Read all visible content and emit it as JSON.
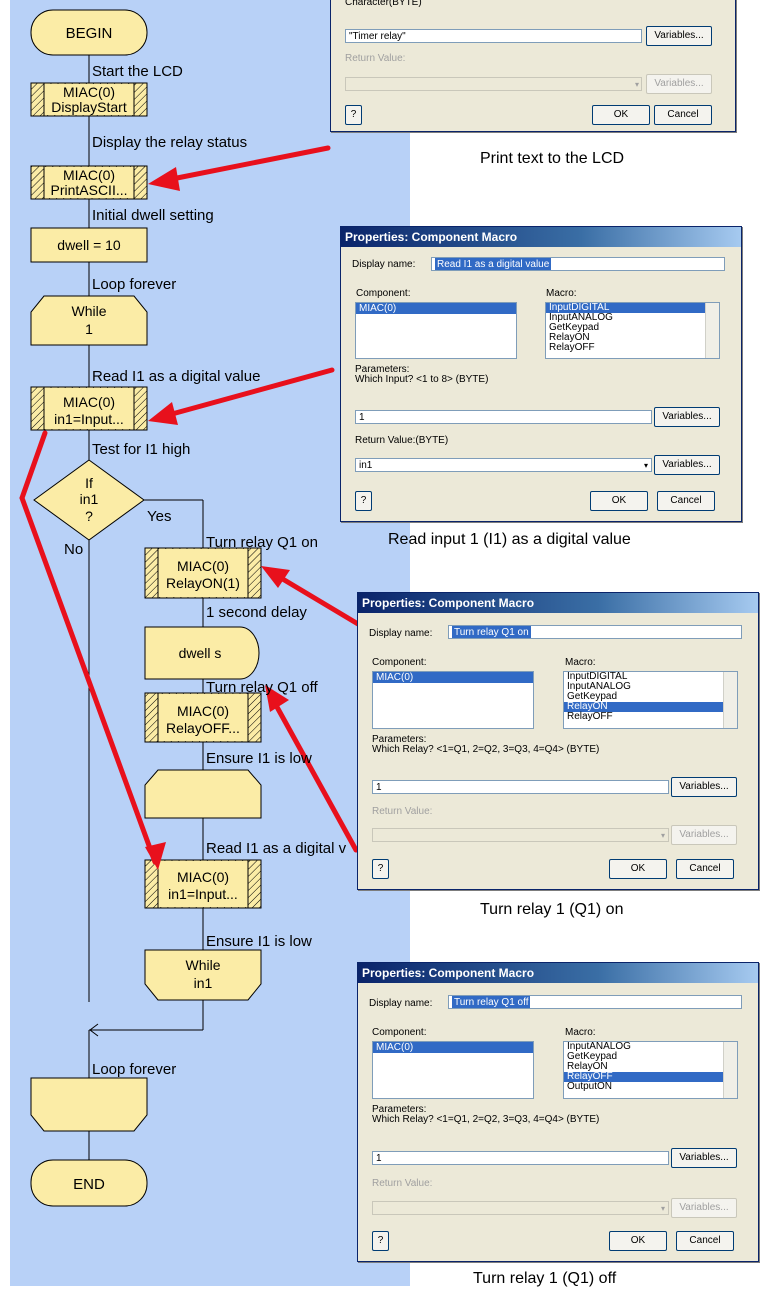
{
  "flowchart": {
    "begin": "BEGIN",
    "end": "END",
    "labels": {
      "start_lcd": "Start the LCD",
      "display_relay": "Display the relay status",
      "initial_dwell": "Initial dwell setting",
      "loop_forever_1": "Loop forever",
      "read_i1_1": "Read I1 as a digital value",
      "test_i1": "Test for I1 high",
      "yes": "Yes",
      "no": "No",
      "relay_on": "Turn relay Q1 on",
      "delay": "1 second delay",
      "relay_off": "Turn relay Q1 off",
      "ensure_low_1": "Ensure I1 is low",
      "read_i1_2": "Read I1 as a digital v",
      "ensure_low_2": "Ensure I1 is low",
      "loop_forever_2": "Loop forever"
    },
    "blocks": {
      "display_start_1": "MIAC(0)",
      "display_start_2": "DisplayStart",
      "print_1": "MIAC(0)",
      "print_2": "PrintASCII...",
      "dwell_calc": "dwell = 10",
      "while1_1": "While",
      "while1_2": "1",
      "input1_1": "MIAC(0)",
      "input1_2": "in1=Input...",
      "if_1": "If",
      "if_2": "in1",
      "if_3": "?",
      "relay_on_1": "MIAC(0)",
      "relay_on_2": "RelayON(1)",
      "delay": "dwell s",
      "relay_off_1": "MIAC(0)",
      "relay_off_2": "RelayOFF...",
      "input2_1": "MIAC(0)",
      "input2_2": "in1=Input...",
      "while2_1": "While",
      "while2_2": "in1"
    }
  },
  "dialog_print": {
    "char_label": "Character(BYTE)",
    "value": "\"Timer relay\"",
    "variables": "Variables...",
    "return_label": "Return Value:",
    "help": "?",
    "ok": "OK",
    "cancel": "Cancel",
    "caption": "Print text to the LCD"
  },
  "dialog_read": {
    "title": "Properties: Component Macro",
    "display_name_label": "Display name:",
    "display_name": "Read I1 as a digital value",
    "component_label": "Component:",
    "component": "MIAC(0)",
    "macro_label": "Macro:",
    "macros": [
      "InputDIGITAL",
      "InputANALOG",
      "GetKeypad",
      "RelayON",
      "RelayOFF"
    ],
    "params_label": "Parameters:",
    "param_desc": "Which Input? <1 to 8> (BYTE)",
    "param_value": "1",
    "variables": "Variables...",
    "return_label": "Return Value:(BYTE)",
    "return_value": "in1",
    "help": "?",
    "ok": "OK",
    "cancel": "Cancel",
    "caption": "Read input 1 (I1) as a digital value"
  },
  "dialog_on": {
    "title": "Properties: Component Macro",
    "display_name_label": "Display name:",
    "display_name": "Turn relay Q1 on",
    "component_label": "Component:",
    "component": "MIAC(0)",
    "macro_label": "Macro:",
    "macros": [
      "InputDIGITAL",
      "InputANALOG",
      "GetKeypad",
      "RelayON",
      "RelayOFF"
    ],
    "params_label": "Parameters:",
    "param_desc": "Which Relay? <1=Q1, 2=Q2, 3=Q3, 4=Q4> (BYTE)",
    "param_value": "1",
    "variables": "Variables...",
    "return_label": "Return Value:",
    "help": "?",
    "ok": "OK",
    "cancel": "Cancel",
    "caption": "Turn relay 1 (Q1) on"
  },
  "dialog_off": {
    "title": "Properties: Component Macro",
    "display_name_label": "Display name:",
    "display_name": "Turn relay Q1 off",
    "component_label": "Component:",
    "component": "MIAC(0)",
    "macro_label": "Macro:",
    "macros": [
      "InputANALOG",
      "GetKeypad",
      "RelayON",
      "RelayOFF",
      "OutputON"
    ],
    "params_label": "Parameters:",
    "param_desc": "Which Relay? <1=Q1, 2=Q2, 3=Q3, 4=Q4> (BYTE)",
    "param_value": "1",
    "variables": "Variables...",
    "return_label": "Return Value:",
    "help": "?",
    "ok": "OK",
    "cancel": "Cancel",
    "caption": "Turn relay 1 (Q1) off"
  },
  "colors": {
    "canvas": "#b8d1f7",
    "block_fill": "#fbeca6",
    "arrow": "#e8101c",
    "dialog_bg": "#ece9d8",
    "title_bar": "#0a246a",
    "selection": "#316ac5"
  }
}
